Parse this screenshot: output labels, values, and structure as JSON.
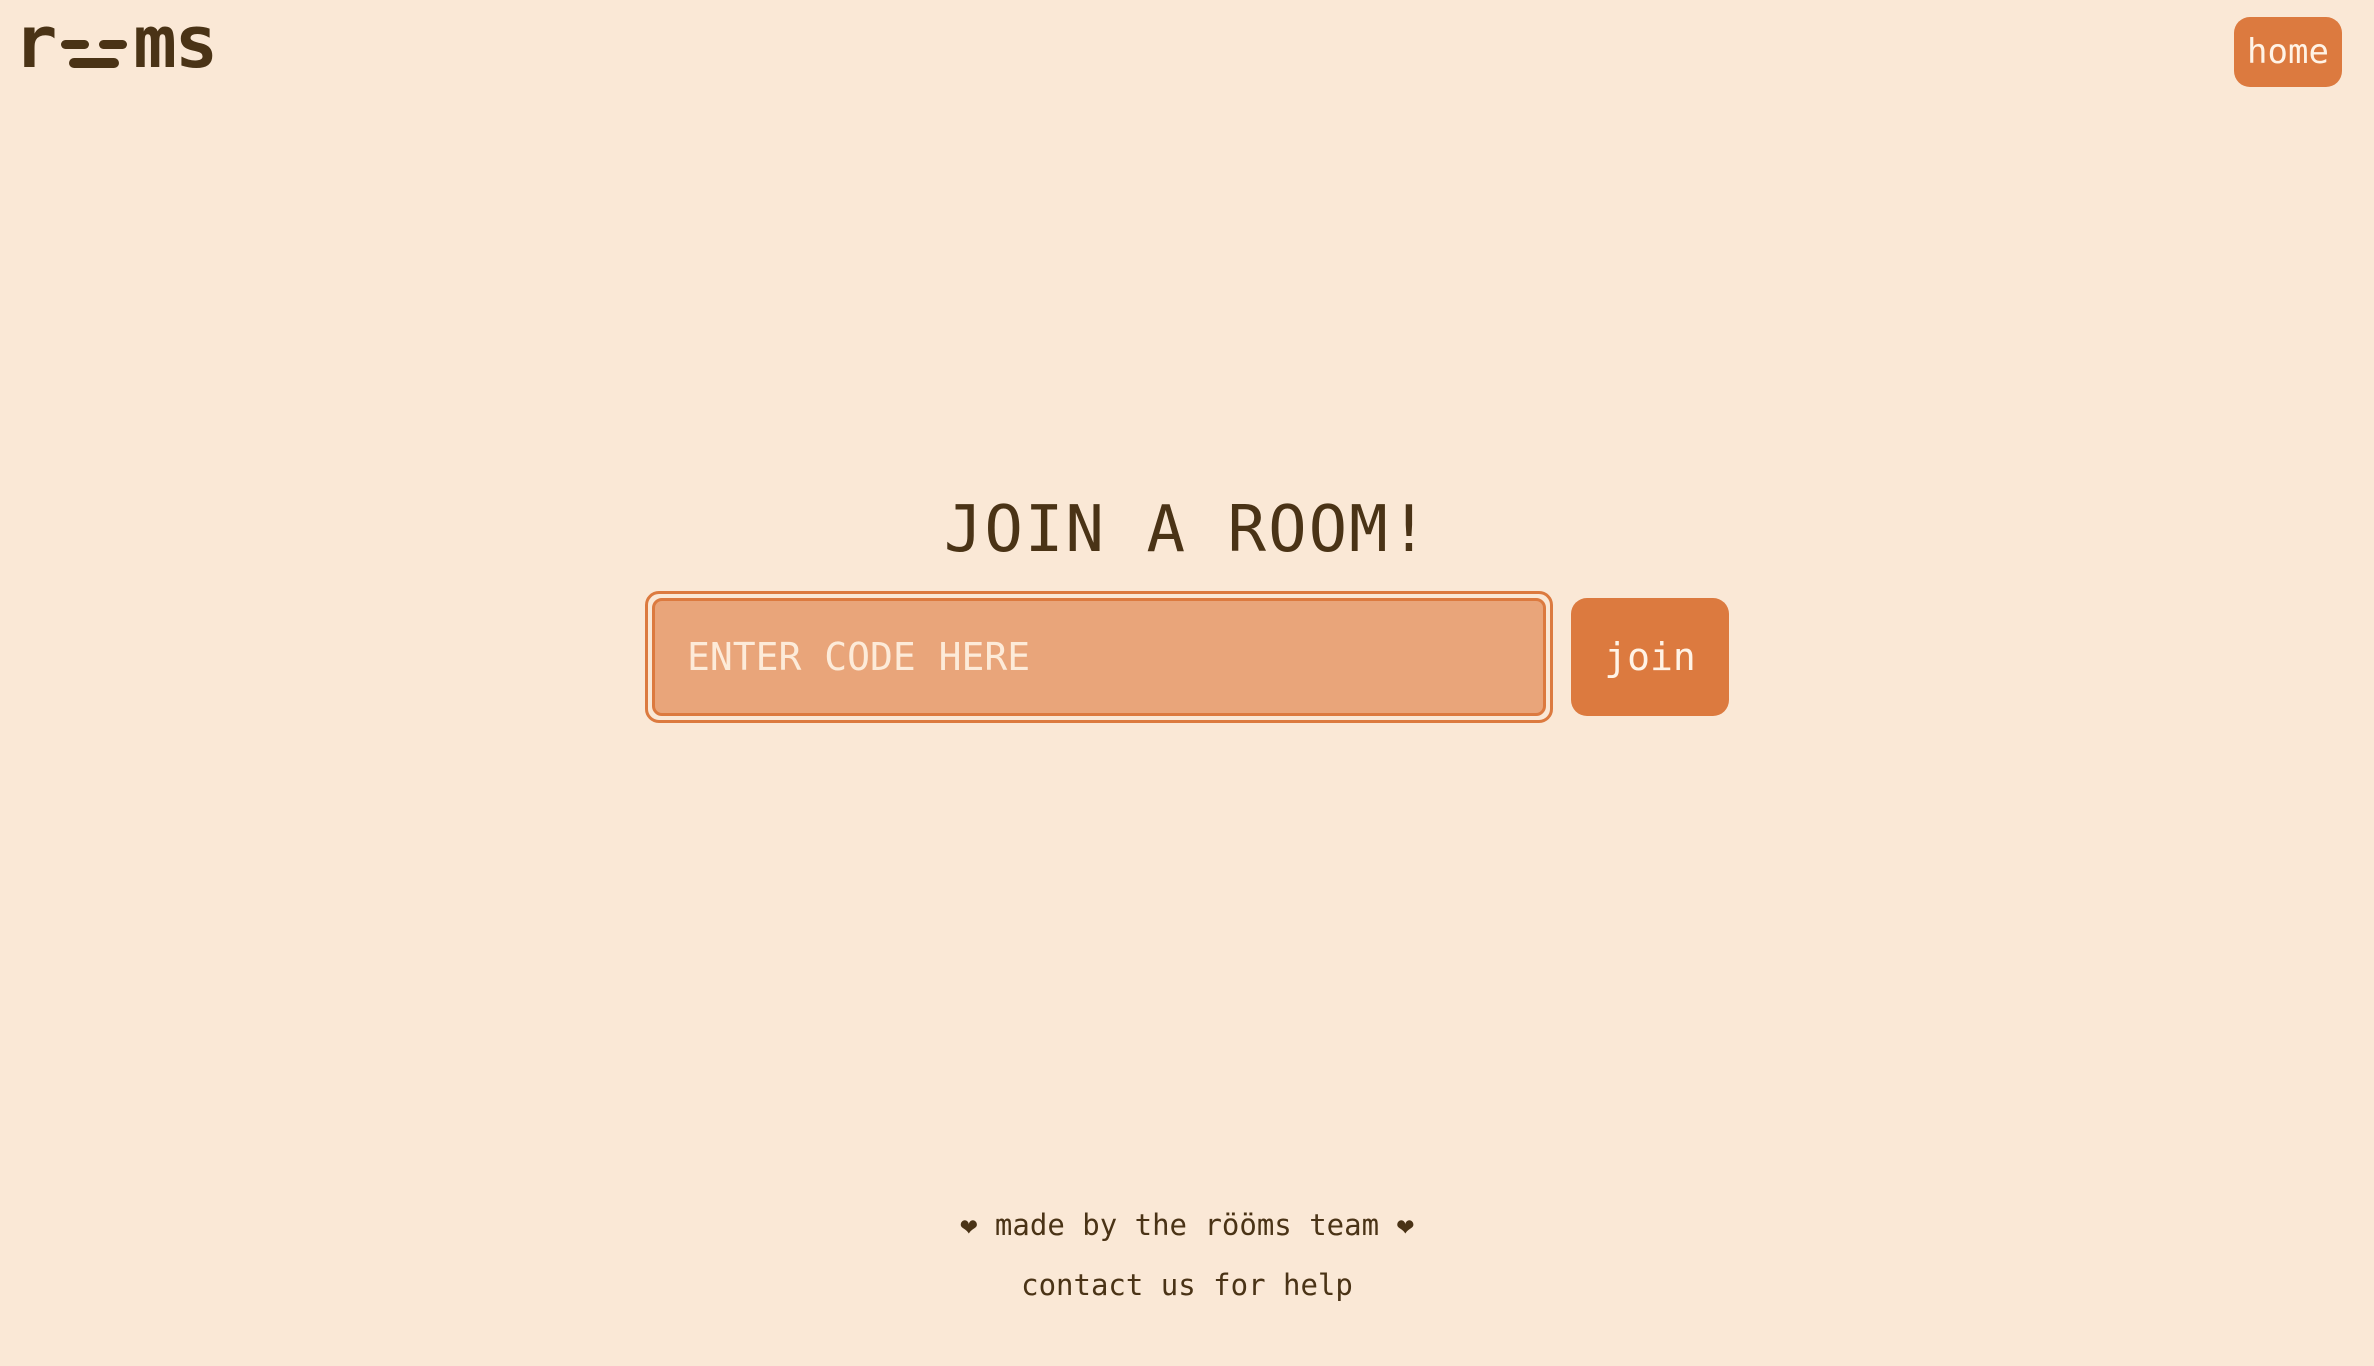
{
  "header": {
    "logo": {
      "left": "r",
      "right": "ms",
      "alt": "rööms"
    },
    "home_label": "home"
  },
  "main": {
    "title": "JOIN A ROOM!",
    "code_input": {
      "placeholder": "ENTER CODE HERE",
      "value": ""
    },
    "join_label": "join"
  },
  "footer": {
    "made_by": "❤ made by the rööms team ❤",
    "contact": "contact us for help"
  },
  "colors": {
    "background": "#FAE8D6",
    "accent": "#DC7A3F",
    "input_fill": "#E9A57A",
    "text": "#4A3316"
  }
}
